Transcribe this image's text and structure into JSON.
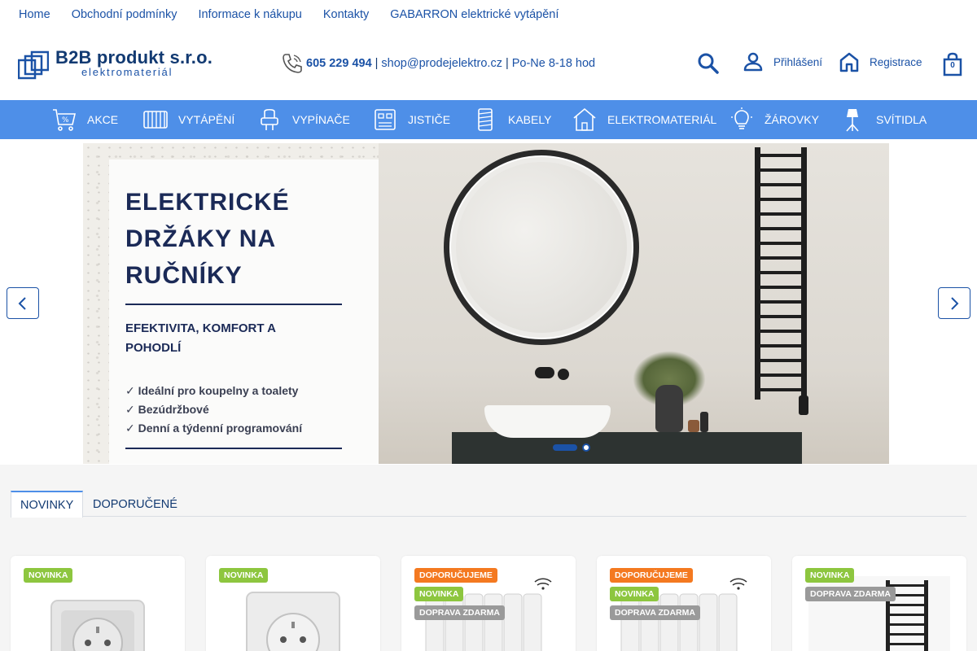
{
  "top_links": [
    "Home",
    "Obchodní podmínky",
    "Informace k nákupu",
    "Kontakty",
    "GABARRON elektrické vytápění"
  ],
  "logo": {
    "name": "B2B produkt s.r.o.",
    "sub": "elektromateriál"
  },
  "contact": {
    "phone": "605 229 494",
    "sep1": "|",
    "email": "shop@prodejelektro.cz",
    "sep2": "|",
    "hours": "Po-Ne 8-18 hod"
  },
  "account": {
    "login": "Přihlášení",
    "register": "Registrace",
    "cart_count": "0"
  },
  "categories": [
    {
      "label": "AKCE",
      "icon": "sale-cart-icon"
    },
    {
      "label": "VYTÁPĚNÍ",
      "icon": "radiator-icon"
    },
    {
      "label": "VYPÍNAČE",
      "icon": "switch-icon"
    },
    {
      "label": "JISTIČE",
      "icon": "breaker-icon"
    },
    {
      "label": "KABELY",
      "icon": "cable-icon"
    },
    {
      "label": "ELEKTROMATERIÁL",
      "icon": "house-icon"
    },
    {
      "label": "ŽÁROVKY",
      "icon": "bulb-icon"
    },
    {
      "label": "SVÍTIDLA",
      "icon": "lamp-icon"
    }
  ],
  "banner": {
    "title_lines": [
      "ELEKTRICKÉ",
      "DRŽÁKY NA",
      "RUČNÍKY"
    ],
    "subtitle_lines": [
      "EFEKTIVITA, KOMFORT A",
      "POHODLÍ"
    ],
    "bullets": [
      "✓ Ideální pro koupelny a toalety",
      "✓ Bezúdržbové",
      "✓ Denní a týdenní programování"
    ],
    "slide_count": 2,
    "active_slide": 1
  },
  "tabs": [
    "NOVINKY",
    "DOPORUČENÉ"
  ],
  "products": [
    {
      "badges": [
        {
          "text": "NOVINKA",
          "color": "green"
        }
      ],
      "image": "socket-icon"
    },
    {
      "badges": [
        {
          "text": "NOVINKA",
          "color": "green"
        }
      ],
      "image": "socket-icon"
    },
    {
      "badges": [
        {
          "text": "DOPORUČUJEME",
          "color": "orange"
        },
        {
          "text": "NOVINKA",
          "color": "green"
        },
        {
          "text": "DOPRAVA ZDARMA",
          "color": "gray"
        }
      ],
      "image": "radiator-wifi-icon"
    },
    {
      "badges": [
        {
          "text": "DOPORUČUJEME",
          "color": "orange"
        },
        {
          "text": "NOVINKA",
          "color": "green"
        },
        {
          "text": "DOPRAVA ZDARMA",
          "color": "gray"
        }
      ],
      "image": "radiator-wifi-icon"
    },
    {
      "badges": [
        {
          "text": "NOVINKA",
          "color": "green"
        },
        {
          "text": "DOPRAVA ZDARMA",
          "color": "gray"
        }
      ],
      "image": "towel-rail-icon"
    }
  ],
  "colors": {
    "primary": "#1b52a6",
    "nav": "#4e8fe8",
    "badge_green": "#8dc63f",
    "badge_orange": "#f47920",
    "badge_gray": "#9a9a9a"
  }
}
